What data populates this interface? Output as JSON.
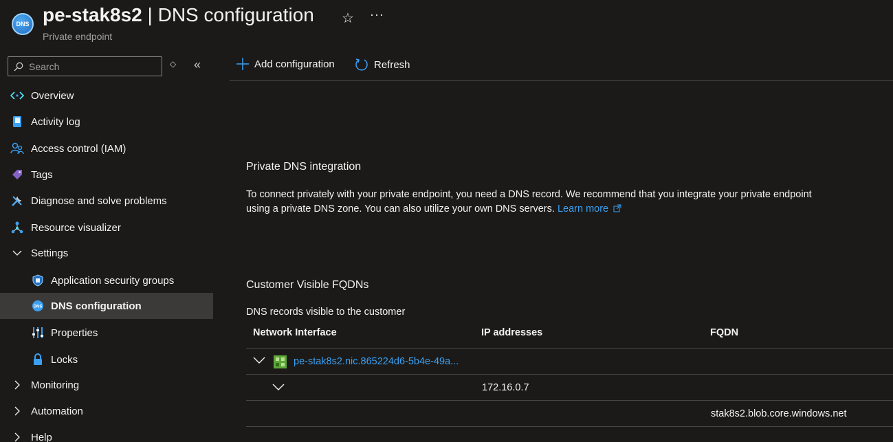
{
  "header": {
    "resource_name": "pe-stak8s2",
    "separator": "|",
    "page_title": "DNS configuration",
    "resource_type": "Private endpoint",
    "icon_text": "DNS"
  },
  "sidebar": {
    "search_placeholder": "Search",
    "items": [
      {
        "label": "Overview",
        "icon": "overview-icon"
      },
      {
        "label": "Activity log",
        "icon": "activity-log-icon"
      },
      {
        "label": "Access control (IAM)",
        "icon": "iam-icon"
      },
      {
        "label": "Tags",
        "icon": "tag-icon"
      },
      {
        "label": "Diagnose and solve problems",
        "icon": "wrench-icon"
      },
      {
        "label": "Resource visualizer",
        "icon": "visualizer-icon"
      },
      {
        "label": "Settings",
        "icon": "chevron-down-icon"
      },
      {
        "label": "Application security groups",
        "icon": "shield-icon"
      },
      {
        "label": "DNS configuration",
        "icon": "dns-icon",
        "active": true
      },
      {
        "label": "Properties",
        "icon": "properties-icon"
      },
      {
        "label": "Locks",
        "icon": "lock-icon"
      },
      {
        "label": "Monitoring",
        "icon": "chevron-right-icon"
      },
      {
        "label": "Automation",
        "icon": "chevron-right-icon"
      },
      {
        "label": "Help",
        "icon": "chevron-right-icon"
      }
    ]
  },
  "toolbar": {
    "add_label": "Add configuration",
    "refresh_label": "Refresh"
  },
  "dns_integration": {
    "title": "Private DNS integration",
    "description": "To connect privately with your private endpoint, you need a DNS record. We recommend that you integrate your private endpoint using a private DNS zone. You can also utilize your own DNS servers.",
    "link_label": "Learn more"
  },
  "fqdns": {
    "title": "Customer Visible FQDNs",
    "subtitle": "DNS records visible to the customer",
    "columns": [
      "Network Interface",
      "IP addresses",
      "FQDN"
    ],
    "nic_name": "pe-stak8s2.nic.865224d6-5b4e-49a...",
    "ip_address": "172.16.0.7",
    "fqdn": "stak8s2.blob.core.windows.net"
  },
  "colors": {
    "background": "#1b1a19",
    "active_item": "#3b3a39",
    "link": "#3aa0f3",
    "accent": "#0078d4"
  }
}
